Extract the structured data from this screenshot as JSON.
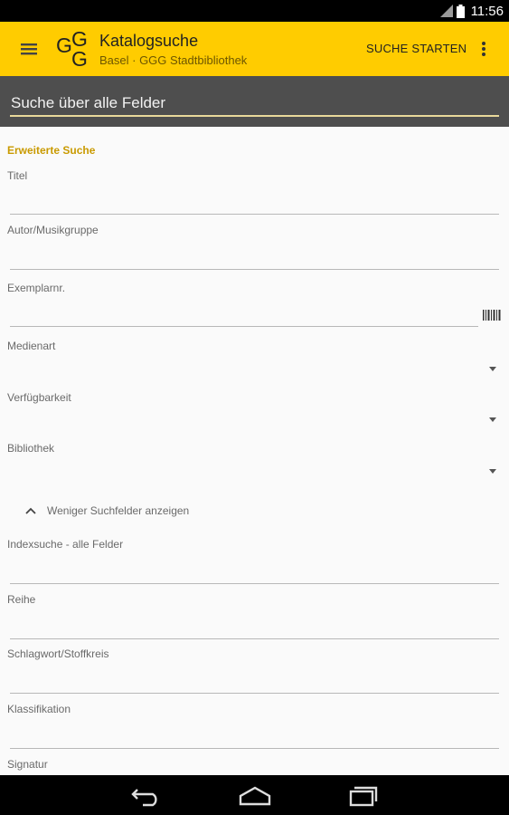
{
  "status_bar": {
    "time": "11:56"
  },
  "app_bar": {
    "logo_text": "GGG",
    "title": "Katalogsuche",
    "subtitle": "Basel · GGG Stadtbibliothek",
    "search_start": "SUCHE STARTEN",
    "menu_icon": "hamburger-menu-icon",
    "overflow_icon": "more-vert-icon"
  },
  "search": {
    "placeholder": "Suche über alle Felder",
    "value": ""
  },
  "advanced": {
    "title": "Erweiterte Suche",
    "fields": {
      "titel": "Titel",
      "autor": "Autor/Musikgruppe",
      "exemplar": "Exemplarnr.",
      "medienart": "Medienart",
      "verfuegbarkeit": "Verfügbarkeit",
      "bibliothek": "Bibliothek",
      "indexsuche": "Indexsuche - alle Felder",
      "reihe": "Reihe",
      "schlagwort": "Schlagwort/Stoffkreis",
      "klassifikation": "Klassifikation",
      "signatur": "Signatur"
    },
    "less_fields": "Weniger Suchfelder anzeigen"
  },
  "colors": {
    "accent": "#ffcc00",
    "section_title": "#c99a00",
    "searchbar": "#4e4e4e"
  },
  "nav_icons": [
    "back-icon",
    "home-icon",
    "recents-icon"
  ]
}
